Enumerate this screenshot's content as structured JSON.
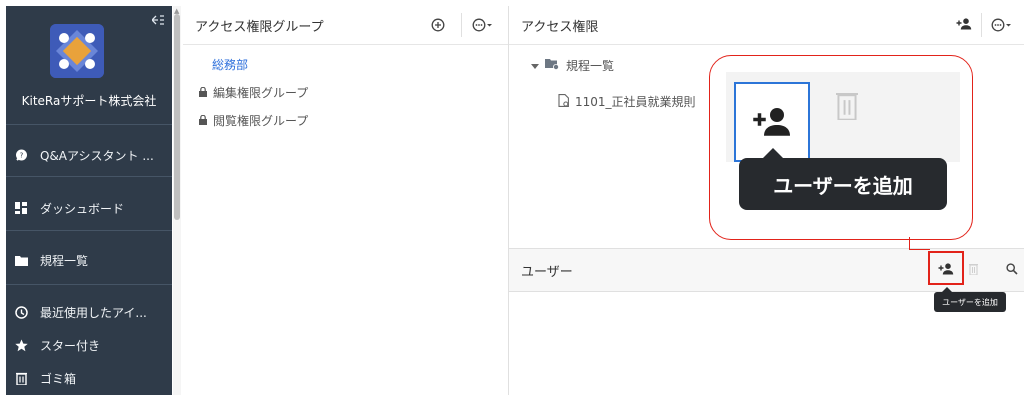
{
  "sidebar": {
    "company_name": "KiteRaサポート株式会社",
    "items": [
      {
        "label": "Q&Aアシスタント ...",
        "icon": "chat-icon"
      },
      {
        "label": "ダッシュボード",
        "icon": "dashboard-icon"
      },
      {
        "label": "規程一覧",
        "icon": "folder-icon"
      },
      {
        "label": "最近使用したアイ...",
        "icon": "clock-icon"
      },
      {
        "label": "スター付き",
        "icon": "star-icon"
      },
      {
        "label": "ゴミ箱",
        "icon": "trash-icon"
      }
    ]
  },
  "left_panel": {
    "title": "アクセス権限グループ",
    "tree": [
      {
        "label": "総務部",
        "selected": true
      },
      {
        "label": "編集権限グループ",
        "locked": true
      },
      {
        "label": "閲覧権限グループ",
        "locked": true
      }
    ]
  },
  "right_panel": {
    "title": "アクセス権限",
    "folder_label": "規程一覧",
    "file_label": "1101_正社員就業規則"
  },
  "users_panel": {
    "title": "ユーザー"
  },
  "callout": {
    "tooltip_text": "ユーザーを追加"
  },
  "small_tooltip": {
    "text": "ユーザーを追加"
  },
  "colors": {
    "sidebar_bg": "#2f3b49",
    "accent_blue": "#2c75d8",
    "highlight_red": "#e2231a"
  }
}
